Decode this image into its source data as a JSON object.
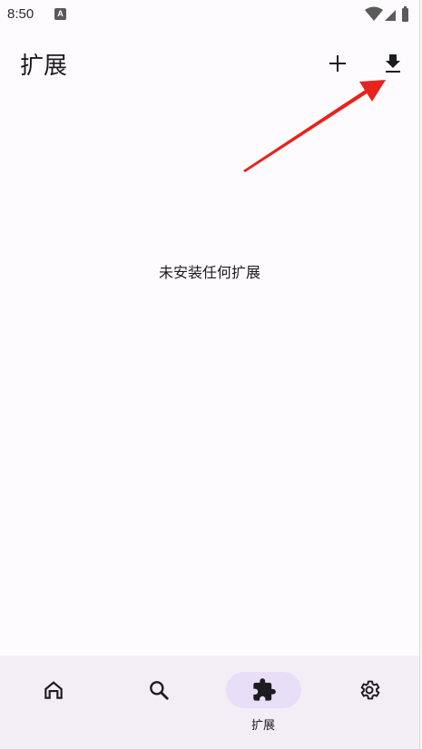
{
  "status_bar": {
    "time": "8:50",
    "app_icon_letter": "A"
  },
  "app_bar": {
    "title": "扩展",
    "actions": [
      {
        "icon": "add-icon"
      },
      {
        "icon": "download-icon"
      }
    ]
  },
  "content": {
    "empty_message": "未安装任何扩展"
  },
  "bottom_nav": {
    "items": [
      {
        "icon": "home-icon",
        "label": "",
        "active": false
      },
      {
        "icon": "search-icon",
        "label": "",
        "active": false
      },
      {
        "icon": "puzzle-icon",
        "label": "扩展",
        "active": true
      },
      {
        "icon": "gear-icon",
        "label": "",
        "active": false
      }
    ]
  },
  "colors": {
    "background": "#fefbfe",
    "nav_background": "#f3edf6",
    "active_indicator": "#e8def8",
    "annotation_arrow": "#e8231c",
    "text": "#1c1b1f"
  }
}
